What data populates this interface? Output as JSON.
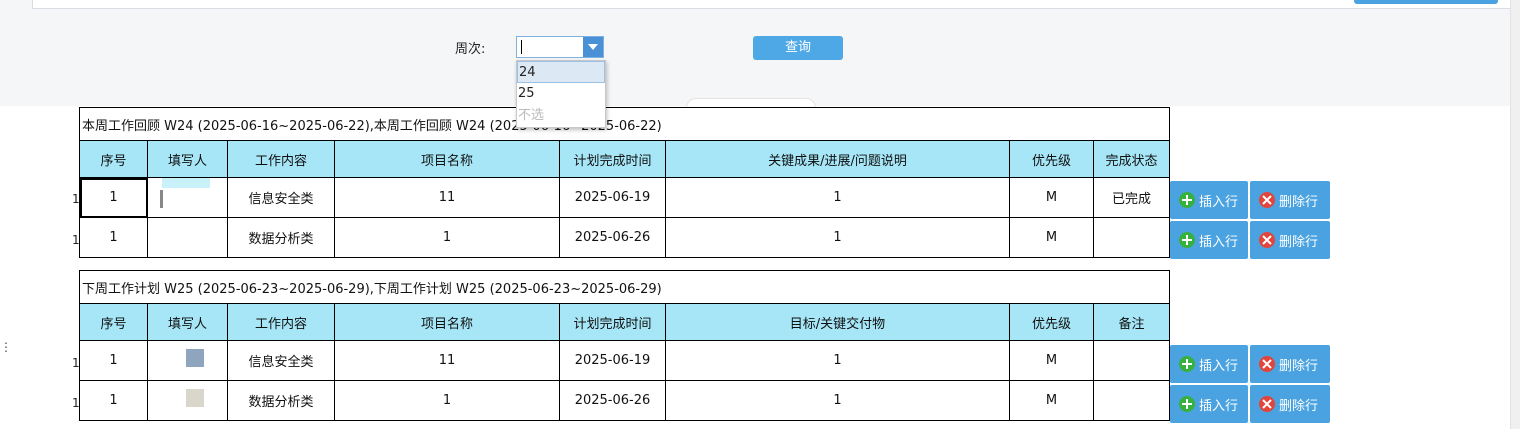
{
  "filter": {
    "week_label": "周次:",
    "week_value": "",
    "week_options": [
      "24",
      "25",
      "不选"
    ],
    "query_label": "查询"
  },
  "review": {
    "title": "本周工作回顾 W24 (2025-06-16~2025-06-22),本周工作回顾 W24 (2025-06-16~2025-06-22)",
    "headers": [
      "序号",
      "填写人",
      "工作内容",
      "项目名称",
      "计划完成时间",
      "关键成果/进展/问题说明",
      "优先级",
      "完成状态"
    ],
    "rows": [
      {
        "mark": "1",
        "no": "1",
        "writer": "",
        "content": "信息安全类",
        "project": "11",
        "date": "2025-06-19",
        "result": "1",
        "priority": "M",
        "status": "已完成"
      },
      {
        "mark": "1",
        "no": "1",
        "writer": "",
        "content": "数据分析类",
        "project": "1",
        "date": "2025-06-26",
        "result": "1",
        "priority": "M",
        "status": ""
      }
    ]
  },
  "plan": {
    "title": "下周工作计划 W25 (2025-06-23~2025-06-29),下周工作计划 W25 (2025-06-23~2025-06-29)",
    "headers": [
      "序号",
      "填写人",
      "工作内容",
      "项目名称",
      "计划完成时间",
      "目标/关键交付物",
      "优先级",
      "备注"
    ],
    "rows": [
      {
        "mark": "1",
        "no": "1",
        "writer": "",
        "content": "信息安全类",
        "project": "11",
        "date": "2025-06-19",
        "result": "1",
        "priority": "M",
        "status": ""
      },
      {
        "mark": "1",
        "no": "1",
        "writer": "",
        "content": "数据分析类",
        "project": "1",
        "date": "2025-06-26",
        "result": "1",
        "priority": "M",
        "status": ""
      }
    ]
  },
  "actions": {
    "insert_label": "插入行",
    "delete_label": "删除行"
  },
  "colors": {
    "header_bg": "#a6e6f7",
    "button_blue": "#4aa3e0",
    "insert_icon": "#36b03f",
    "delete_icon": "#e2453c"
  }
}
